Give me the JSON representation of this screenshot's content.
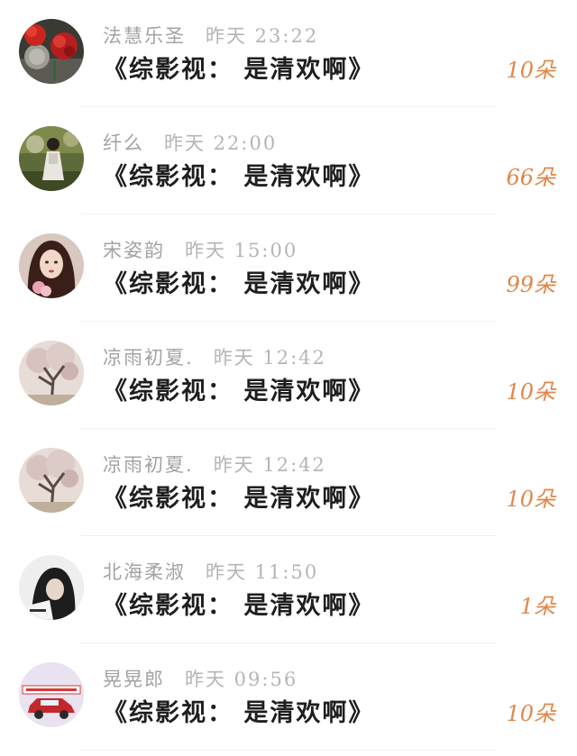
{
  "messages": [
    {
      "name": "法慧乐圣",
      "time": "昨天 23:22",
      "title": "《综影视： 是清欢啊》",
      "count": "10朵",
      "avatar": "red-flowers-avatar"
    },
    {
      "name": "纤么",
      "time": "昨天 22:00",
      "title": "《综影视： 是清欢啊》",
      "count": "66朵",
      "avatar": "girl-in-field-avatar"
    },
    {
      "name": "宋姿韵",
      "time": "昨天 15:00",
      "title": "《综影视： 是清欢啊》",
      "count": "99朵",
      "avatar": "girl-portrait-avatar"
    },
    {
      "name": "凉雨初夏.",
      "time": "昨天 12:42",
      "title": "《综影视： 是清欢啊》",
      "count": "10朵",
      "avatar": "blossom-tree-avatar"
    },
    {
      "name": "凉雨初夏.",
      "time": "昨天 12:42",
      "title": "《综影视： 是清欢啊》",
      "count": "10朵",
      "avatar": "blossom-tree-avatar"
    },
    {
      "name": "北海柔淑",
      "time": "昨天 11:50",
      "title": "《综影视： 是清欢啊》",
      "count": "1朵",
      "avatar": "hooded-girl-avatar"
    },
    {
      "name": "晃晃郎",
      "time": "昨天 09:56",
      "title": "《综影视： 是清欢啊》",
      "count": "10朵",
      "avatar": "red-car-avatar"
    }
  ]
}
